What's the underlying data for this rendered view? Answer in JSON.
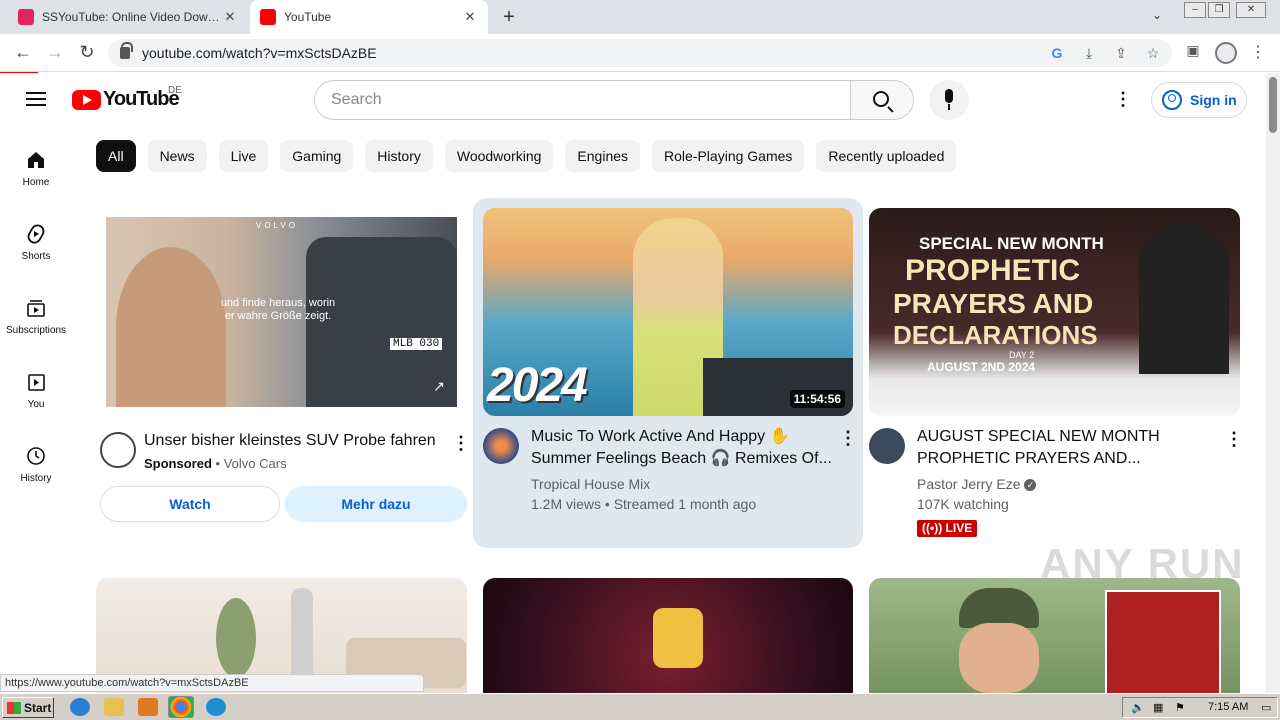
{
  "browser": {
    "tabs": [
      {
        "title": "SSYouTube: Online Video Downloade",
        "active": false,
        "favicon_color": "#e0245e"
      },
      {
        "title": "YouTube",
        "active": true,
        "favicon_color": "#ff0000"
      }
    ],
    "url": "youtube.com/watch?v=mxSctsDAzBE",
    "status_url": "https://www.youtube.com/watch?v=mxSctsDAzBE"
  },
  "youtube": {
    "region": "DE",
    "logo_text": "YouTube",
    "search_placeholder": "Search",
    "signin_label": "Sign in",
    "sidebar": [
      {
        "label": "Home",
        "icon": "home-icon"
      },
      {
        "label": "Shorts",
        "icon": "shorts-icon"
      },
      {
        "label": "Subscriptions",
        "icon": "subscriptions-icon"
      },
      {
        "label": "You",
        "icon": "you-icon"
      },
      {
        "label": "History",
        "icon": "history-icon"
      }
    ],
    "chips": [
      "All",
      "News",
      "Live",
      "Gaming",
      "History",
      "Woodworking",
      "Engines",
      "Role-Playing Games",
      "Recently uploaded"
    ],
    "ad": {
      "thumb_text": "und finde heraus, worin er wahre Größe zeigt.",
      "brand_text": "VOLVO",
      "plate": "MLB 030",
      "title": "Unser bisher kleinstes SUV Probe fahren",
      "sponsored": "Sponsored",
      "advertiser": "Volvo Cars",
      "watch_label": "Watch",
      "more_label": "Mehr dazu"
    },
    "videos": [
      {
        "title_line1": "Music To Work Active And Happy ✋",
        "title_line2": "Summer Feelings Beach 🎧 Remixes Of...",
        "channel": "Tropical House Mix",
        "stats": "1.2M views • Streamed 1 month ago",
        "duration": "11:54:56",
        "thumb_text": "2024"
      },
      {
        "title_line1": "AUGUST SPECIAL NEW MONTH",
        "title_line2": "PROPHETIC PRAYERS AND...",
        "channel": "Pastor Jerry Eze",
        "stats": "107K watching",
        "live_badge": "LIVE",
        "thumb_line1": "SPECIAL NEW MONTH",
        "thumb_line2": "PROPHETIC",
        "thumb_line3": "PRAYERS AND",
        "thumb_line4": "DECLARATIONS",
        "thumb_line5": "DAY 2",
        "thumb_line6": "AUGUST 2ND 2024"
      }
    ]
  },
  "taskbar": {
    "start_label": "Start",
    "clock": "7:15 AM"
  },
  "watermark": "ANY RUN"
}
